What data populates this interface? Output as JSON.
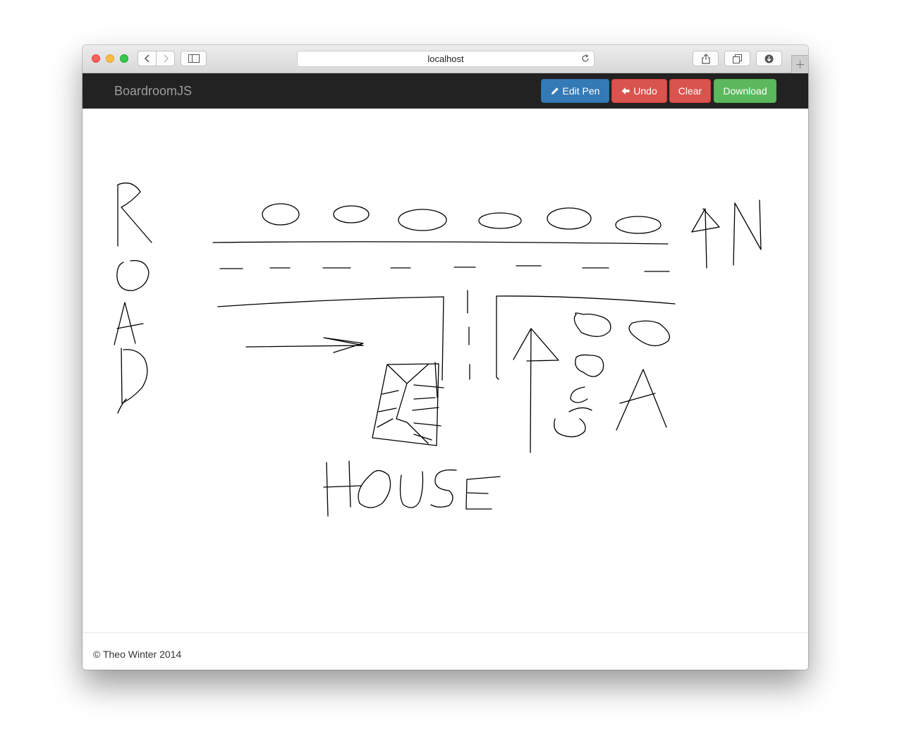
{
  "browser": {
    "address": "localhost",
    "icons": [
      "back-icon",
      "forward-icon",
      "sidebar-icon",
      "reload-icon",
      "share-icon",
      "tabs-icon",
      "download-icon",
      "plus-icon"
    ]
  },
  "navbar": {
    "brand": "BoardroomJS",
    "edit_pen_label": "Edit Pen",
    "undo_label": "Undo",
    "clear_label": "Clear",
    "download_label": "Download"
  },
  "colors": {
    "navbar_bg": "#222222",
    "primary": "#337ab7",
    "danger": "#d9534f",
    "success": "#5cb85c"
  },
  "footer": {
    "text": "© Theo Winter 2014"
  }
}
